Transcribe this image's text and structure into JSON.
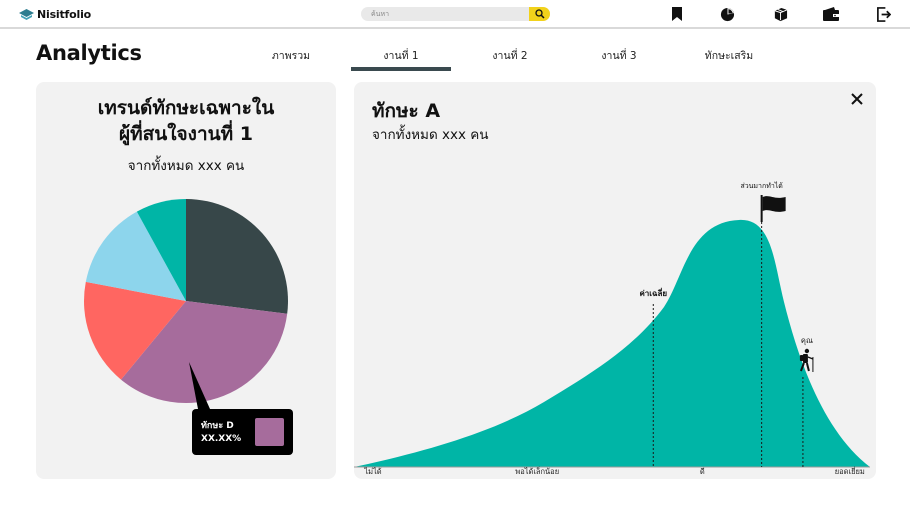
{
  "app": {
    "name": "Nisitfolio"
  },
  "search": {
    "placeholder": "ค้นหา"
  },
  "nav": {
    "icons": [
      "bookmark-icon",
      "pie-chart-icon",
      "cube-icon",
      "wallet-icon",
      "logout-icon"
    ]
  },
  "page": {
    "title": "Analytics"
  },
  "tabs": [
    {
      "label": "ภาพรวม"
    },
    {
      "label": "งานที่ 1",
      "active": true
    },
    {
      "label": "งานที่ 2"
    },
    {
      "label": "งานที่ 3"
    },
    {
      "label": "ทักษะเสริม"
    }
  ],
  "left_card": {
    "title_line1": "เทรนด์ทักษะเฉพาะใน",
    "title_line2": "ผู้ที่สนใจงานที่ 1",
    "subtitle": "จากทั้งหมด xxx คน"
  },
  "tooltip": {
    "name": "ทักษะ D",
    "value": "XX.XX%",
    "color": "#a66c9c"
  },
  "right_card": {
    "title": "ทักษะ A",
    "subtitle": "จากทั้งหมด xxx คน"
  },
  "chart_data": [
    {
      "type": "pie",
      "slices": [
        {
          "value": 27,
          "color": "#374749"
        },
        {
          "value": 34,
          "color": "#a66c9c"
        },
        {
          "value": 17,
          "color": "#ff6661"
        },
        {
          "value": 14,
          "color": "#8dd5ec"
        },
        {
          "value": 8,
          "color": "#00b5a6"
        }
      ]
    },
    {
      "type": "area",
      "x_labels": [
        "ไม่ได้",
        "พอได้เล็กน้อย",
        "ดี",
        "ยอดเยี่ยม"
      ],
      "color": "#00b5a6",
      "markers": [
        {
          "label": "ค่าเฉลี่ย",
          "x": 0.58
        },
        {
          "label": "ส่วนมากทำได้",
          "x": 0.79
        },
        {
          "label": "คุณ",
          "x": 0.87
        }
      ]
    }
  ]
}
